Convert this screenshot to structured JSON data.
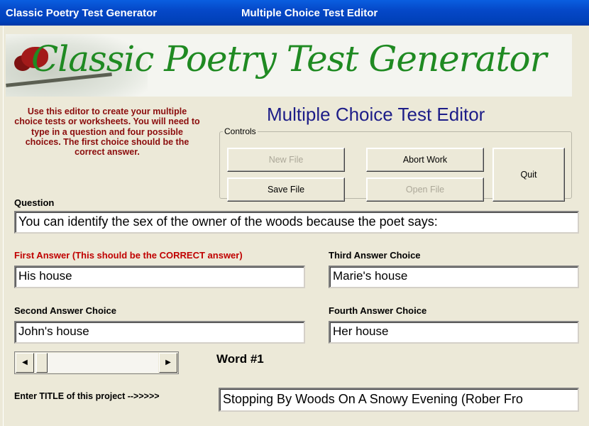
{
  "titlebar": {
    "app_name": "Classic Poetry Test Generator",
    "window_title": "Multiple Choice Test Editor"
  },
  "banner": {
    "title": "Classic Poetry Test Generator"
  },
  "instructions": "Use this editor to create your multiple choice tests or worksheets.  You will need to type in a question and four possible choices.  The first choice should be the correct answer.",
  "editor_title": "Multiple Choice Test Editor",
  "controls": {
    "legend": "Controls",
    "new_file": "New File",
    "save_file": "Save File",
    "abort_work": "Abort Work",
    "open_file": "Open File",
    "quit": "Quit"
  },
  "question": {
    "label": "Question",
    "value": "You can identify the sex of the owner of the woods because the poet says:"
  },
  "answers": {
    "first": {
      "label": "First Answer (This should be the CORRECT answer)",
      "value": "His house"
    },
    "second": {
      "label": "Second Answer Choice",
      "value": "John's house"
    },
    "third": {
      "label": "Third Answer Choice",
      "value": "Marie's house"
    },
    "fourth": {
      "label": "Fourth Answer Choice",
      "value": "Her house"
    }
  },
  "word_counter": "Word #1",
  "project": {
    "label": "Enter TITLE of this project -->>>>>",
    "value": "Stopping By Woods On A Snowy Evening (Rober Fro"
  },
  "icons": {
    "scroll_left": "left-arrow-icon",
    "scroll_right": "right-arrow-icon"
  },
  "colors": {
    "accent_red": "#c00000",
    "instruction_red": "#8b0d0d",
    "title_blue": "#1d1d88",
    "banner_green": "#1f8a22"
  }
}
